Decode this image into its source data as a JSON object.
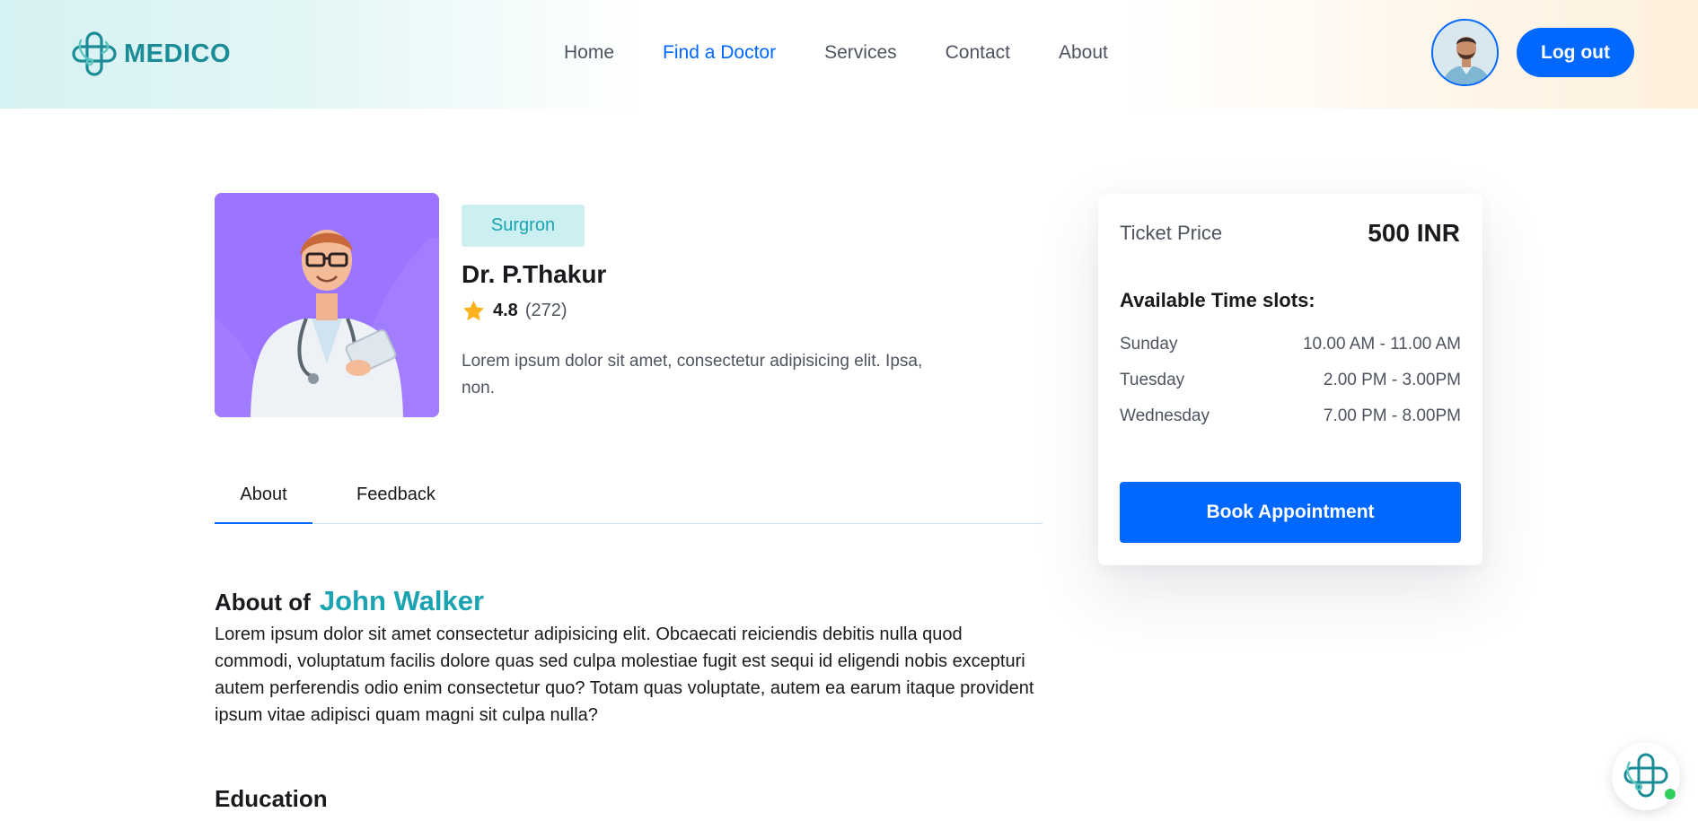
{
  "brand": {
    "name": "MEDICO",
    "accent": "#0067ff",
    "teal": "#1aa3b0"
  },
  "nav": {
    "items": [
      {
        "label": "Home",
        "active": false
      },
      {
        "label": "Find a Doctor",
        "active": true
      },
      {
        "label": "Services",
        "active": false
      },
      {
        "label": "Contact",
        "active": false
      },
      {
        "label": "About",
        "active": false
      }
    ]
  },
  "header": {
    "logout_label": "Log out",
    "avatar_icon": "user-avatar"
  },
  "doctor": {
    "specialty": "Surgron",
    "name": "Dr. P.Thakur",
    "rating": "4.8",
    "reviews": "(272)",
    "description": "Lorem ipsum dolor sit amet, consectetur adipisicing elit. Ipsa, non."
  },
  "tabs": [
    {
      "label": "About",
      "active": true
    },
    {
      "label": "Feedback",
      "active": false
    }
  ],
  "about": {
    "heading_prefix": "About of",
    "heading_name": "John Walker",
    "text": "Lorem ipsum dolor sit amet consectetur adipisicing elit. Obcaecati reiciendis debitis nulla quod commodi, voluptatum facilis dolore quas sed culpa molestiae fugit est sequi id eligendi nobis excepturi autem perferendis odio enim consectetur quo? Totam quas voluptate, autem ea earum itaque provident ipsum vitae adipisci quam magni sit culpa nulla?",
    "education_heading": "Education"
  },
  "booking": {
    "price_label": "Ticket Price",
    "price_value": "500 INR",
    "slots_title": "Available Time slots:",
    "slots": [
      {
        "day": "Sunday",
        "time": "10.00 AM - 11.00 AM"
      },
      {
        "day": "Tuesday",
        "time": "2.00 PM - 3.00PM"
      },
      {
        "day": "Wednesday",
        "time": "7.00 PM - 8.00PM"
      }
    ],
    "book_label": "Book Appointment"
  },
  "chat_widget": {
    "icon": "medico-chat-icon",
    "status_color": "#2fcd5c"
  }
}
